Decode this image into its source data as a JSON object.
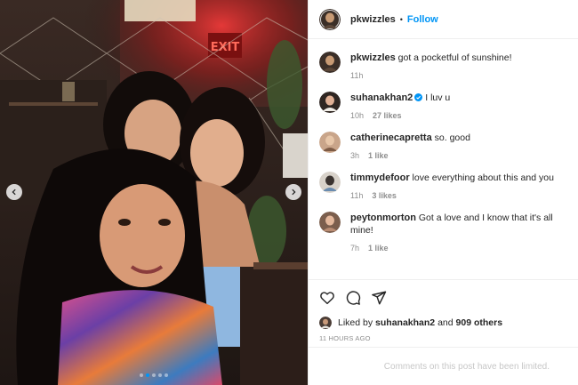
{
  "post": {
    "author": "pkwizzles",
    "follow_label": "Follow",
    "separator": "•",
    "caption": {
      "user": "pkwizzles",
      "text": "got a pocketful of sunshine!",
      "time": "11h"
    },
    "comments": [
      {
        "user": "suhanakhan2",
        "verified": true,
        "text": "I luv u",
        "time": "10h",
        "likes": "27 likes"
      },
      {
        "user": "catherinecapretta",
        "verified": false,
        "text": "so. good",
        "time": "3h",
        "likes": "1 like"
      },
      {
        "user": "timmydefoor",
        "verified": false,
        "text": "love everything about this and you",
        "time": "11h",
        "likes": "3 likes"
      },
      {
        "user": "peytonmorton",
        "verified": false,
        "text": "Got a love and I know that it's all mine!",
        "time": "7h",
        "likes": "1 like"
      }
    ],
    "liked_by": {
      "prefix": "Liked by",
      "user": "suhanakhan2",
      "and": "and",
      "others": "909 others"
    },
    "timestamp": "11 HOURS AGO",
    "comments_limited": "Comments on this post have been limited.",
    "carousel": {
      "slide_count": 5,
      "active_index": 1
    },
    "scene_sign": "EXIT"
  },
  "colors": {
    "link": "#0095f6",
    "text": "#262626",
    "muted": "#8e8e8e",
    "border": "#efefef"
  },
  "icons": {
    "prev": "chevron-left-icon",
    "next": "chevron-right-icon",
    "like": "heart-icon",
    "comment": "comment-icon",
    "share": "paper-plane-icon",
    "verified": "verified-badge-icon"
  }
}
